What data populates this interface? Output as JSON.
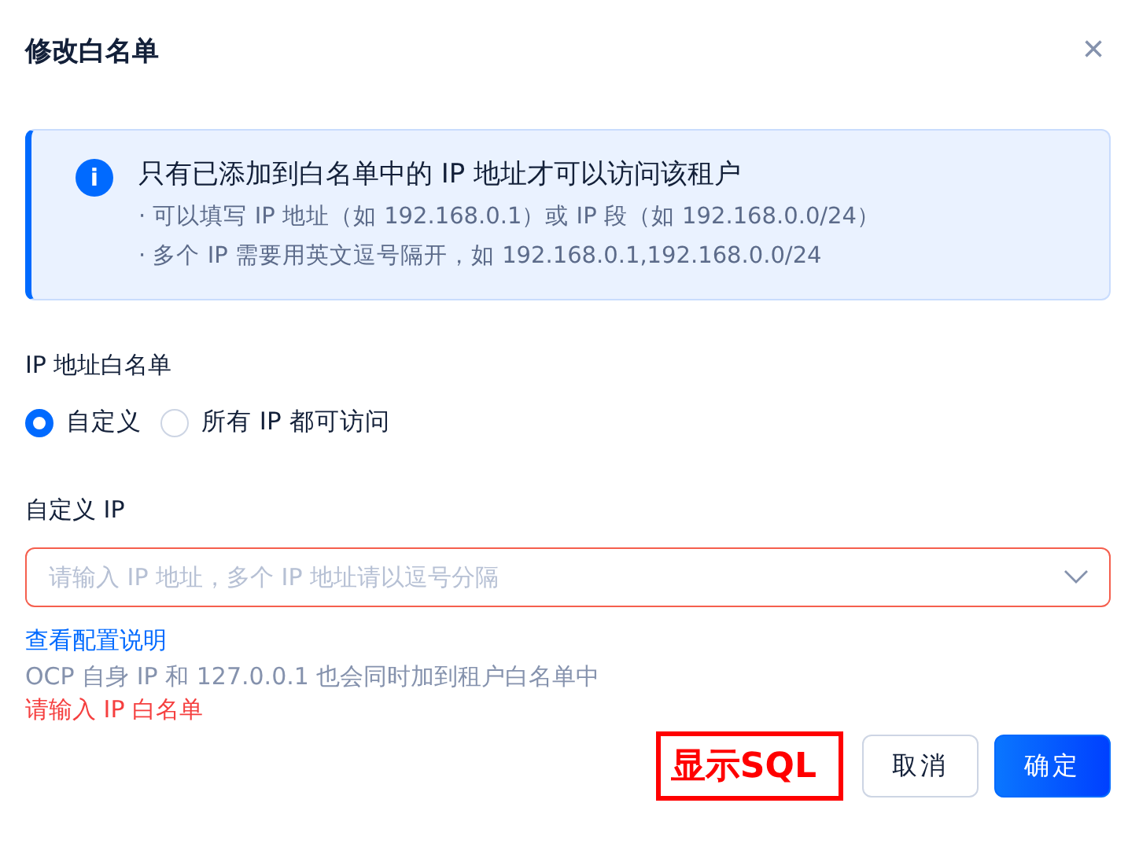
{
  "title": "修改白名单",
  "close": "×",
  "info": {
    "icon": "i",
    "heading": "只有已添加到白名单中的 IP 地址才可以访问该租户",
    "lines": [
      "· 可以填写 IP 地址（如 192.168.0.1）或 IP 段（如 192.168.0.0/24）",
      "· 多个 IP 需要用英文逗号隔开，如 192.168.0.1,192.168.0.0/24"
    ]
  },
  "whitelist": {
    "label": "IP 地址白名单",
    "options": [
      {
        "label": "自定义",
        "selected": true
      },
      {
        "label": "所有 IP 都可访问",
        "selected": false
      }
    ]
  },
  "custom_ip": {
    "label": "自定义 IP",
    "placeholder": "请输入 IP 地址，多个 IP 地址请以逗号分隔",
    "error": true,
    "link": "查看配置说明",
    "hint": "OCP 自身 IP 和 127.0.0.1 也会同时加到租户白名单中",
    "error_text": "请输入 IP 白名单"
  },
  "annotation": "显示SQL",
  "buttons": [
    {
      "label": "取消",
      "kind": "secondary"
    },
    {
      "label": "确定",
      "kind": "primary"
    }
  ]
}
